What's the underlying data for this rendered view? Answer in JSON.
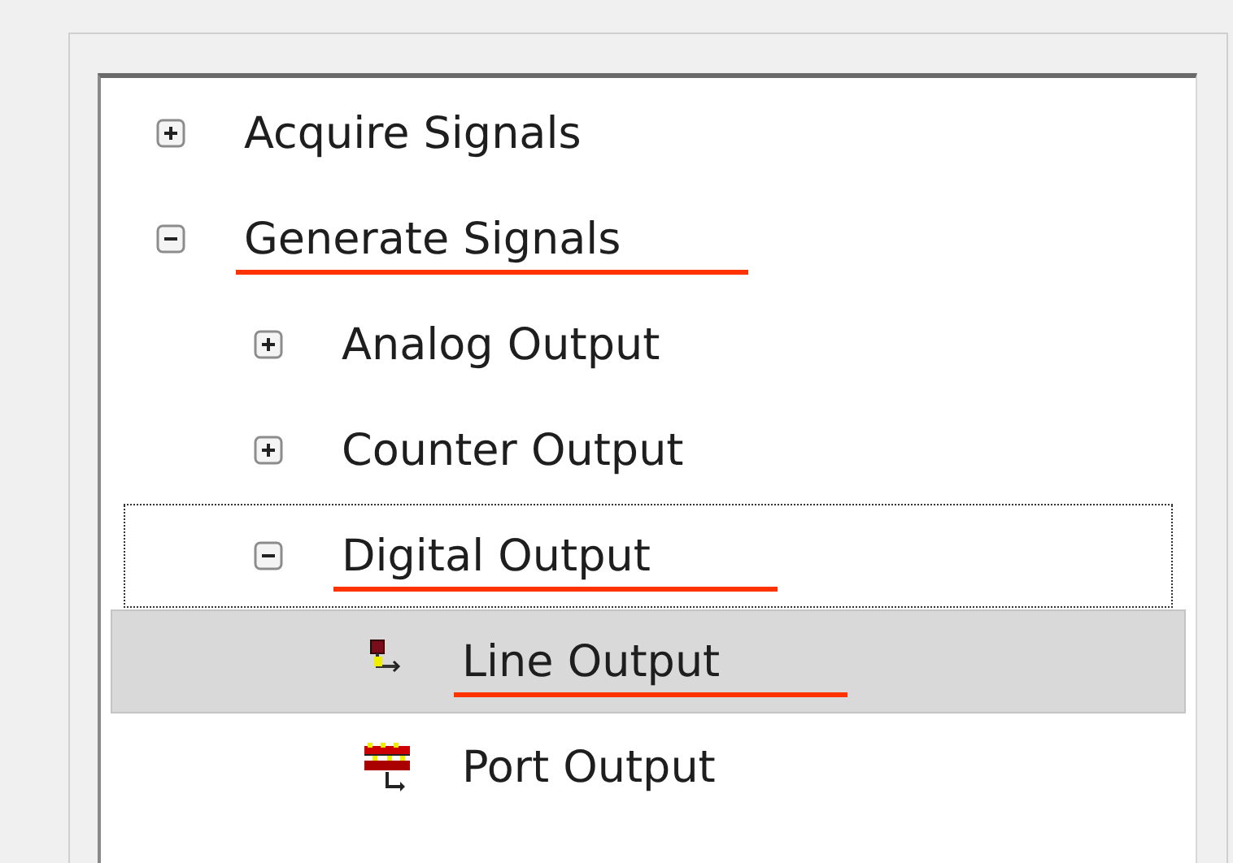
{
  "tree": {
    "items": [
      {
        "label": "Acquire Signals",
        "expanded": false,
        "selected": false,
        "focused": false,
        "underlined": false
      },
      {
        "label": "Generate Signals",
        "expanded": true,
        "selected": false,
        "focused": false,
        "underlined": true,
        "children": [
          {
            "label": "Analog Output",
            "expanded": false,
            "selected": false,
            "focused": false,
            "underlined": false
          },
          {
            "label": "Counter Output",
            "expanded": false,
            "selected": false,
            "focused": false,
            "underlined": false
          },
          {
            "label": "Digital Output",
            "expanded": true,
            "selected": false,
            "focused": true,
            "underlined": true,
            "children": [
              {
                "label": "Line Output",
                "kind": "line",
                "selected": true,
                "focused": false,
                "underlined": true
              },
              {
                "label": "Port Output",
                "kind": "port",
                "selected": false,
                "focused": false,
                "underlined": false
              }
            ]
          }
        ]
      }
    ]
  }
}
